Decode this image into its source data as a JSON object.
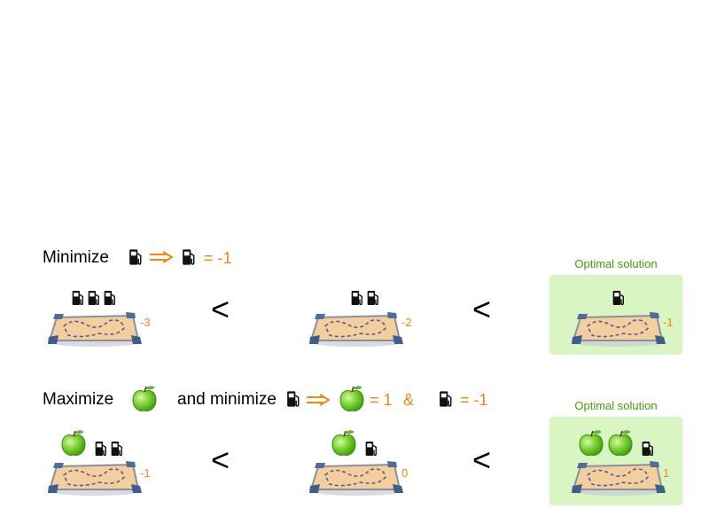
{
  "row1": {
    "heading": "Minimize",
    "equation": "= -1",
    "optimal_label": "Optimal solution",
    "less_than": "<",
    "solutions": [
      {
        "score": "-3",
        "pumps": 3,
        "apples": 0
      },
      {
        "score": "-2",
        "pumps": 2,
        "apples": 0
      },
      {
        "score": "-1",
        "pumps": 1,
        "apples": 0
      }
    ]
  },
  "row2": {
    "heading": "Maximize",
    "and_minimize": "and minimize",
    "eq_apple": "= 1",
    "ampersand": "&",
    "eq_pump": "= -1",
    "optimal_label": "Optimal solution",
    "less_than": "<",
    "solutions": [
      {
        "score": "-1",
        "pumps": 2,
        "apples": 1
      },
      {
        "score": "0",
        "pumps": 1,
        "apples": 1
      },
      {
        "score": "1",
        "pumps": 1,
        "apples": 2
      }
    ]
  },
  "colors": {
    "accent": "#ee8811",
    "optimal_bg": "#daf5c4",
    "optimal_text": "#4d9a06"
  },
  "icons": [
    "fuel-pump-icon",
    "apple-icon",
    "map-icon",
    "arrow-icon"
  ]
}
